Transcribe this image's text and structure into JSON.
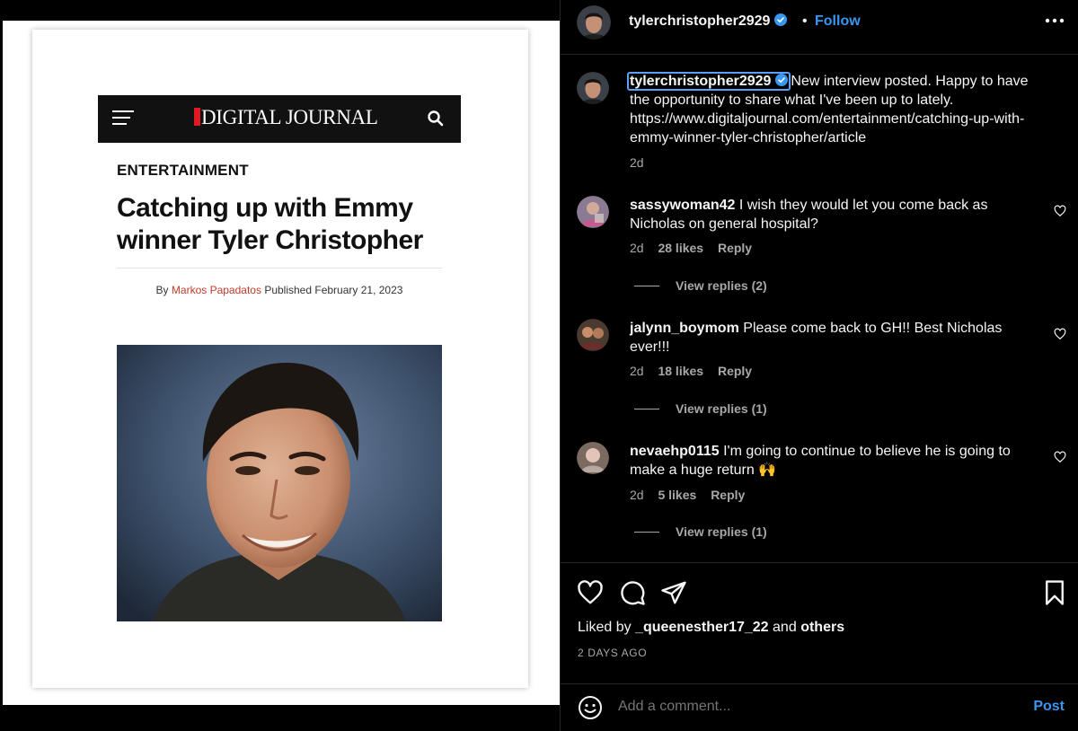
{
  "post": {
    "username": "tylerchristopher2929",
    "separator": "•",
    "follow_label": "Follow",
    "caption": "New interview posted. Happy to have the opportunity to share what I've been up to lately. https://www.digitaljournal.com/entertainment/catching-up-with-emmy-winner-tyler-christopher/article",
    "caption_age": "2d",
    "liked_by_prefix": "Liked by",
    "liked_by_user": "_queenesther17_22",
    "liked_by_and": "and",
    "liked_by_others": "others",
    "posted_ago": "2 DAYS AGO",
    "comment_placeholder": "Add a comment...",
    "post_label": "Post"
  },
  "article": {
    "brand": "DIGITAL JOURNAL",
    "section": "ENTERTAINMENT",
    "title": "Catching up with Emmy winner Tyler Christopher",
    "by_label": "By",
    "author": "Markos Papadatos",
    "published_label": "Published",
    "published_date": "February 21, 2023"
  },
  "comments": [
    {
      "username": "sassywoman42",
      "text": "I wish they would let you come back as Nicholas on general hospital?",
      "age": "2d",
      "likes": "28 likes",
      "reply": "Reply",
      "view_replies": "View replies (2)"
    },
    {
      "username": "jalynn_boymom",
      "text": "Please come back to GH!! Best Nicholas ever!!!",
      "age": "2d",
      "likes": "18 likes",
      "reply": "Reply",
      "view_replies": "View replies (1)"
    },
    {
      "username": "nevaehp0115",
      "text": "I'm going to continue to believe he is going to make a huge return 🙌",
      "age": "2d",
      "likes": "5 likes",
      "reply": "Reply",
      "view_replies": "View replies (1)"
    }
  ],
  "icons": {
    "menu": "hamburger-menu-icon",
    "search": "search-icon",
    "verified": "verified-badge-icon",
    "more": "more-options-icon",
    "like": "heart-icon",
    "comment": "comment-icon",
    "share": "share-icon",
    "save": "bookmark-icon",
    "emoji": "emoji-icon"
  },
  "colors": {
    "accent": "#3897f0",
    "brand_red": "#e11a22",
    "author_red": "#c0392b",
    "muted": "#a8a8a8"
  }
}
